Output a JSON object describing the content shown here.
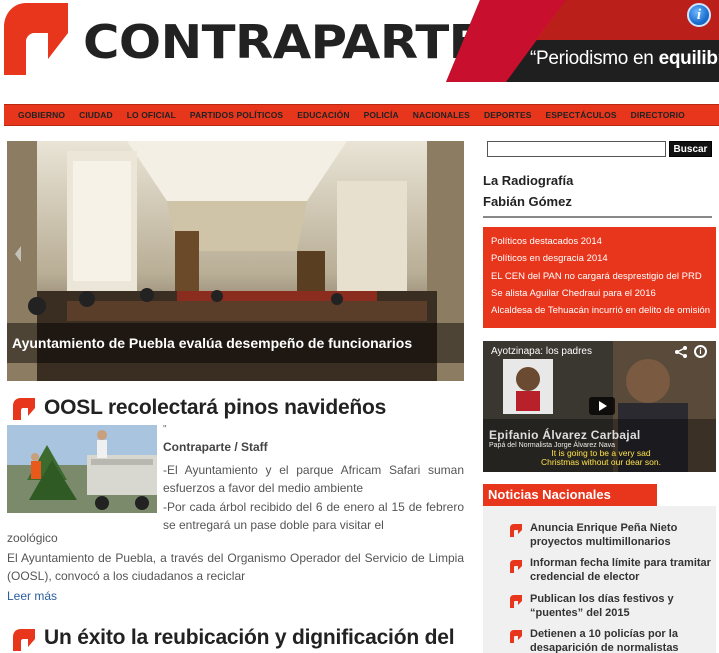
{
  "header": {
    "logo_text": "CONTRAPARTE",
    "slogan_prefix": "“Periodismo en ",
    "slogan_bold": "equilibr",
    "colors": {
      "brand_red": "#e8361c",
      "dark": "#222222"
    }
  },
  "nav": {
    "items": [
      "GOBIERNO",
      "CIUDAD",
      "LO OFICIAL",
      "PARTIDOS POLÍTICOS",
      "EDUCACIÓN",
      "POLICÍA",
      "NACIONALES",
      "DEPORTES",
      "ESPECTÁCULOS",
      "DIRECTORIO"
    ]
  },
  "hero": {
    "caption": "Ayuntamiento de Puebla evalúa desempeño de funcionarios"
  },
  "article1": {
    "title": "OOSL recolectará pinos navideños",
    "quote_mark": "\"",
    "byline": "Contraparte / Staff",
    "bullet1": "-El Ayuntamiento y el parque Africam Safari suman esfuerzos a favor del medio ambiente",
    "bullet2": "-Por cada árbol recibido del 6 de enero al 15 de febrero se entregará un pase doble para visitar el",
    "bullet2_cont": "zoológico",
    "paragraph": "El Ayuntamiento de Puebla, a través del Organismo Operador del Servicio de Limpia (OOSL), convocó a los ciudadanos a reciclar",
    "read_more": "Leer más"
  },
  "article2": {
    "title": "Un éxito la reubicación y dignificación del"
  },
  "sidebar": {
    "search_placeholder": "",
    "search_button": "Buscar",
    "radiografia_line1": "La Radiografía",
    "radiografia_line2": "Fabián Gómez",
    "red_links": [
      "Políticos destacados 2014",
      "Políticos en desgracia 2014",
      "EL CEN del PAN no cargará desprestigio del PRD",
      "Se alista Aguilar Chedraui para el 2016",
      "Alcaldesa de Tehuacán incurrió en delito de omisión"
    ],
    "video": {
      "title": "Ayotzinapa: los padres",
      "name_overlay": "Epifanio Álvarez Carbajal",
      "sub_overlay": "Papá del Normalista Jorge Álvarez Nava",
      "caption_line1": "It is going to be a very sad",
      "caption_line2": "Christmas without our dear son."
    },
    "noticias_nacionales": {
      "title": "Noticias Nacionales",
      "items": [
        "Anuncia Enrique Peña Nieto proyectos multimillonarios",
        "Informan fecha límite para tramitar credencial de elector",
        "Publican los días festivos y “puentes” del 2015",
        "Detienen a 10 policías por la desaparición de normalistas"
      ]
    }
  }
}
